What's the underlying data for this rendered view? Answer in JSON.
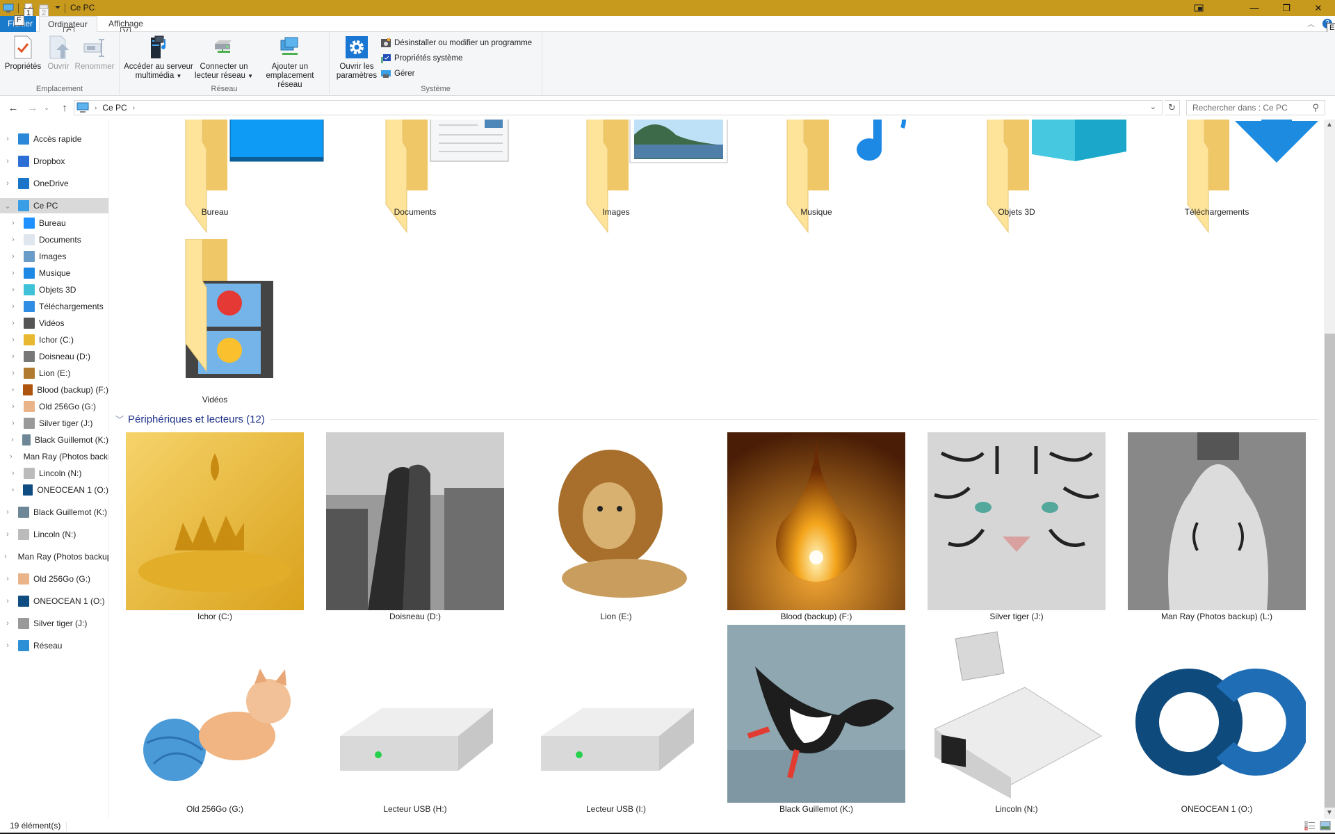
{
  "window": {
    "title": "Ce PC",
    "accent_color": "#c79a1e",
    "controls": {
      "mode_icon": "tablet-mode-icon",
      "minimize": "—",
      "restore": "❐",
      "close": "✕"
    }
  },
  "keytips": {
    "qat1": "1",
    "qat2": "2",
    "file": "F",
    "computer": "C",
    "view": "V",
    "help": "E"
  },
  "ribbon": {
    "tabs": [
      {
        "label": "Fichier",
        "active": false
      },
      {
        "label": "Ordinateur",
        "active": true
      },
      {
        "label": "Affichage",
        "active": false
      }
    ],
    "groups": [
      {
        "label": "Emplacement",
        "buttons": [
          {
            "label": "Propriétés",
            "icon": "properties-icon",
            "enabled": true
          },
          {
            "label": "Ouvrir",
            "icon": "open-icon",
            "enabled": false
          },
          {
            "label": "Renommer",
            "icon": "rename-icon",
            "enabled": false
          }
        ]
      },
      {
        "label": "Réseau",
        "buttons": [
          {
            "label_line1": "Accéder au serveur",
            "label_line2": "multimédia",
            "icon": "media-server-icon",
            "dropdown": true
          },
          {
            "label_line1": "Connecter un",
            "label_line2": "lecteur réseau",
            "icon": "map-network-drive-icon",
            "dropdown": true
          },
          {
            "label_line1": "Ajouter un",
            "label_line2": "emplacement réseau",
            "icon": "add-network-location-icon",
            "dropdown": false
          }
        ]
      },
      {
        "label": "Système",
        "buttons": [
          {
            "label_line1": "Ouvrir les",
            "label_line2": "paramètres",
            "icon": "settings-gear-icon"
          }
        ],
        "small_buttons": [
          {
            "label": "Désinstaller ou modifier un programme",
            "icon": "uninstall-program-icon"
          },
          {
            "label": "Propriétés système",
            "icon": "system-properties-icon"
          },
          {
            "label": "Gérer",
            "icon": "manage-icon"
          }
        ]
      }
    ]
  },
  "navigation": {
    "breadcrumb": [
      "Ce PC"
    ],
    "search_placeholder": "Rechercher dans : Ce PC"
  },
  "tree": [
    {
      "label": "Accès rapide",
      "level": 0,
      "icon": "quick-access-star-icon",
      "color": "#2b88d8"
    },
    {
      "label": "Dropbox",
      "level": 0,
      "icon": "dropbox-icon",
      "color": "#2e6fd6"
    },
    {
      "label": "OneDrive",
      "level": 0,
      "icon": "onedrive-cloud-icon",
      "color": "#1a74c7"
    },
    {
      "label": "Ce PC",
      "level": 0,
      "icon": "this-pc-icon",
      "color": "#3a9ee6",
      "expanded": true,
      "selected": true
    },
    {
      "label": "Bureau",
      "level": 1,
      "icon": "desktop-icon",
      "color": "#1e90ff"
    },
    {
      "label": "Documents",
      "level": 1,
      "icon": "documents-icon",
      "color": "#dfe6ee"
    },
    {
      "label": "Images",
      "level": 1,
      "icon": "pictures-icon",
      "color": "#6a9cc8"
    },
    {
      "label": "Musique",
      "level": 1,
      "icon": "music-note-icon",
      "color": "#1e88e5"
    },
    {
      "label": "Objets 3D",
      "level": 1,
      "icon": "3d-objects-icon",
      "color": "#3fc1d8"
    },
    {
      "label": "Téléchargements",
      "level": 1,
      "icon": "downloads-arrow-icon",
      "color": "#2f8de4"
    },
    {
      "label": "Vidéos",
      "level": 1,
      "icon": "videos-icon",
      "color": "#555"
    },
    {
      "label": "Ichor (C:)",
      "level": 1,
      "icon": "drive-ichor-icon",
      "color": "#e8b830"
    },
    {
      "label": "Doisneau (D:)",
      "level": 1,
      "icon": "drive-doisneau-icon",
      "color": "#777"
    },
    {
      "label": "Lion (E:)",
      "level": 1,
      "icon": "drive-lion-icon",
      "color": "#b07a30"
    },
    {
      "label": "Blood (backup) (F:)",
      "level": 1,
      "icon": "drive-blood-icon",
      "color": "#b0550f"
    },
    {
      "label": "Old 256Go (G:)",
      "level": 1,
      "icon": "drive-kitten-icon",
      "color": "#e9b48a"
    },
    {
      "label": "Silver tiger (J:)",
      "level": 1,
      "icon": "drive-tiger-icon",
      "color": "#999"
    },
    {
      "label": "Black Guillemot (K:)",
      "level": 1,
      "icon": "drive-guillemot-icon",
      "color": "#6d8797"
    },
    {
      "label": "Man Ray (Photos backup) (L:)",
      "level": 1,
      "icon": "drive-manray-icon",
      "color": "#666"
    },
    {
      "label": "Lincoln (N:)",
      "level": 1,
      "icon": "drive-usb-crystal-icon",
      "color": "#bbb"
    },
    {
      "label": "ONEOCEAN 1 (O:)",
      "level": 1,
      "icon": "drive-oneocean-icon",
      "color": "#0f4c81"
    },
    {
      "label": "Black Guillemot (K:)",
      "level": 0,
      "icon": "drive-guillemot-icon",
      "color": "#6d8797"
    },
    {
      "label": "Lincoln (N:)",
      "level": 0,
      "icon": "drive-usb-crystal-icon",
      "color": "#bbb"
    },
    {
      "label": "Man Ray (Photos backup) (L:)",
      "level": 0,
      "icon": "drive-manray-icon",
      "color": "#666"
    },
    {
      "label": "Old 256Go (G:)",
      "level": 0,
      "icon": "drive-kitten-icon",
      "color": "#e9b48a"
    },
    {
      "label": "ONEOCEAN 1 (O:)",
      "level": 0,
      "icon": "drive-oneocean-icon",
      "color": "#0f4c81"
    },
    {
      "label": "Silver tiger (J:)",
      "level": 0,
      "icon": "drive-tiger-icon",
      "color": "#999"
    },
    {
      "label": "Réseau",
      "level": 0,
      "icon": "network-icon",
      "color": "#2d8fd5"
    }
  ],
  "folders": [
    {
      "label": "Bureau",
      "icon": "desktop-folder-icon"
    },
    {
      "label": "Documents",
      "icon": "documents-folder-icon"
    },
    {
      "label": "Images",
      "icon": "pictures-folder-icon"
    },
    {
      "label": "Musique",
      "icon": "music-folder-icon"
    },
    {
      "label": "Objets 3D",
      "icon": "3d-objects-folder-icon"
    },
    {
      "label": "Téléchargements",
      "icon": "downloads-folder-icon"
    },
    {
      "label": "Vidéos",
      "icon": "videos-folder-icon"
    }
  ],
  "devices_section": {
    "title": "Périphériques et lecteurs (12)",
    "count": 12
  },
  "devices": [
    {
      "label": "Ichor (C:)",
      "icon": "golden-drop-drive-icon",
      "bg": "#e8b62b"
    },
    {
      "label": "Doisneau (D:)",
      "icon": "doisneau-kiss-drive-icon",
      "bg": "#8a8a8a"
    },
    {
      "label": "Lion (E:)",
      "icon": "lion-drive-icon",
      "bg": "#ffffff"
    },
    {
      "label": "Blood (backup) (F:)",
      "icon": "blood-drop-drive-icon",
      "bg": "#7a3a0c"
    },
    {
      "label": "Silver tiger (J:)",
      "icon": "white-tiger-drive-icon",
      "bg": "#b9b9b9"
    },
    {
      "label": "Man Ray (Photos backup) (L:)",
      "icon": "violon-ingres-drive-icon",
      "bg": "#8f8f8f"
    },
    {
      "label": "Old 256Go (G:)",
      "icon": "kitten-yarn-drive-icon",
      "bg": "#ffffff"
    },
    {
      "label": "Lecteur USB (H:)",
      "icon": "usb-drive-icon",
      "bg": "#ffffff"
    },
    {
      "label": "Lecteur USB (I:)",
      "icon": "usb-drive-icon",
      "bg": "#ffffff"
    },
    {
      "label": "Black Guillemot (K:)",
      "icon": "black-guillemot-drive-icon",
      "bg": "#8ea3ad"
    },
    {
      "label": "Lincoln (N:)",
      "icon": "crystal-usb-stick-drive-icon",
      "bg": "#ffffff"
    },
    {
      "label": "ONEOCEAN 1 (O:)",
      "icon": "oneocean-logo-drive-icon",
      "bg": "#ffffff"
    }
  ],
  "status": {
    "item_count": "19 élément(s)"
  },
  "scroll": {
    "position_fraction": 0.3,
    "visible_fraction": 0.7
  }
}
